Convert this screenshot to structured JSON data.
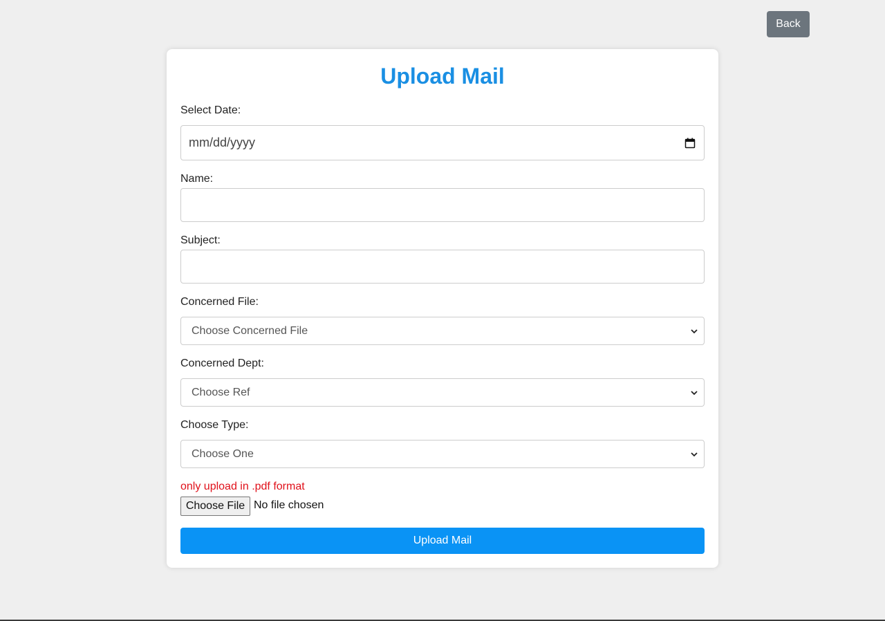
{
  "header": {
    "back_label": "Back"
  },
  "form": {
    "title": "Upload Mail",
    "date": {
      "label": "Select Date:",
      "placeholder": "mm/dd/yyyy"
    },
    "name": {
      "label": "Name:",
      "value": ""
    },
    "subject": {
      "label": "Subject:",
      "value": ""
    },
    "concerned_file": {
      "label": "Concerned File:",
      "selected": "Choose Concerned File"
    },
    "concerned_dept": {
      "label": "Concerned Dept:",
      "selected": "Choose Ref"
    },
    "type": {
      "label": "Choose Type:",
      "selected": "Choose One"
    },
    "upload": {
      "hint": "only upload in .pdf format",
      "choose_file_label": "Choose File",
      "file_status": "No file chosen"
    },
    "submit_label": "Upload Mail"
  },
  "colors": {
    "background": "#efefef",
    "title": "#1a8fe3",
    "submit": "#0a93f5",
    "back": "#6c757d",
    "hint": "#e0101a"
  }
}
